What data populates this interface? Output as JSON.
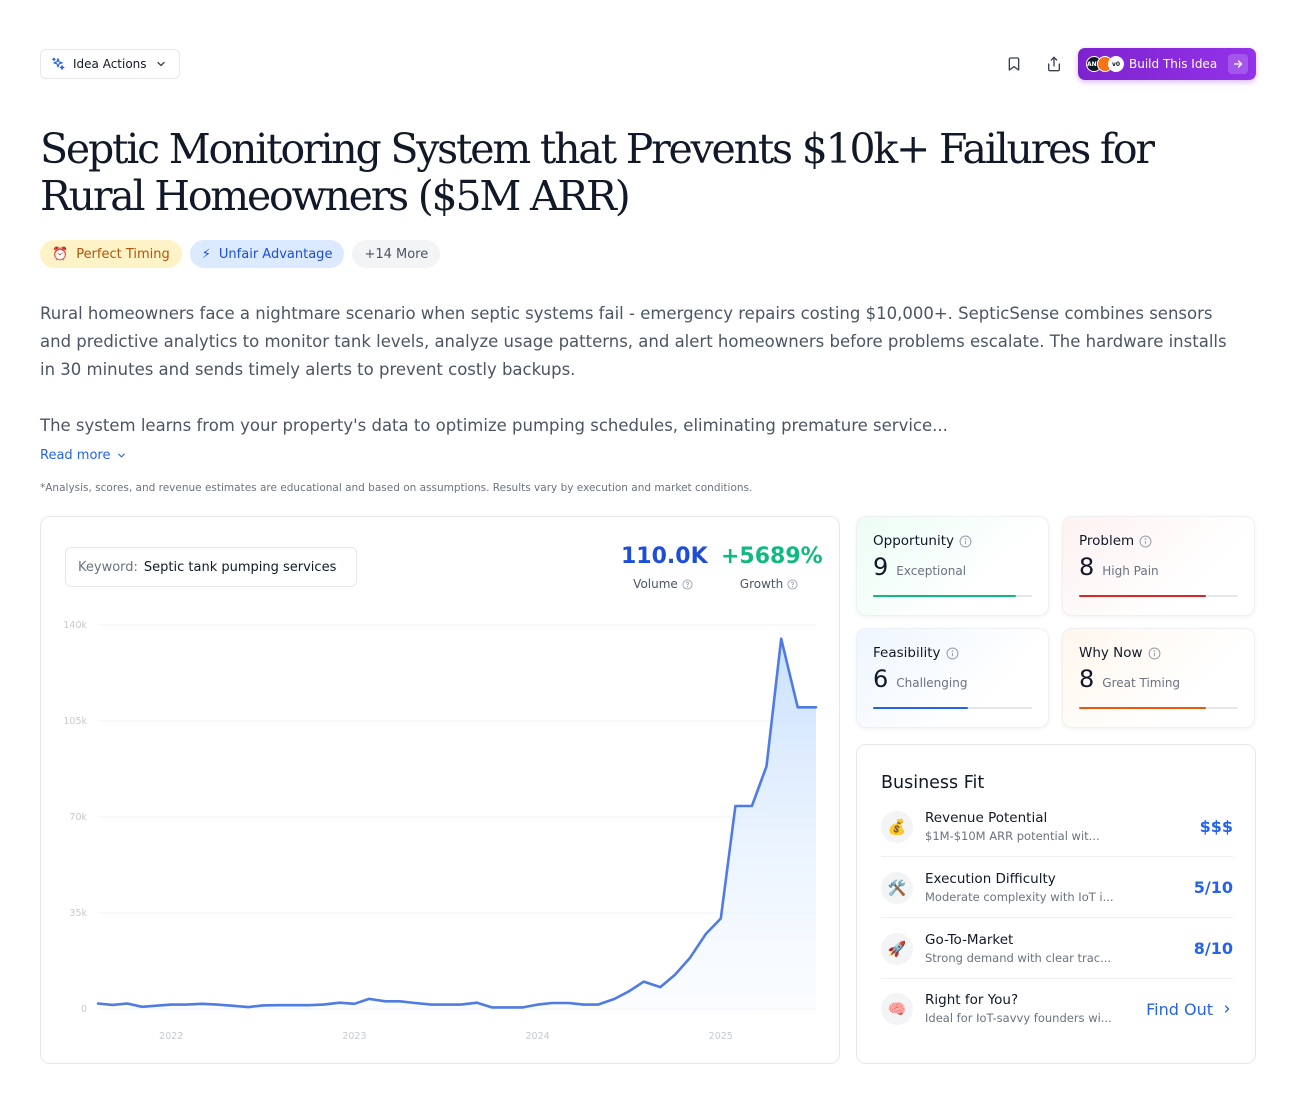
{
  "toolbar": {
    "idea_actions_label": "Idea Actions",
    "build_label": "Build This Idea",
    "logo_1": "ANY",
    "logo_3": "v0"
  },
  "title": "Septic Monitoring System that Prevents $10k+ Failures for Rural Homeowners ($5M ARR)",
  "tags": [
    {
      "icon": "⏰",
      "label": "Perfect Timing"
    },
    {
      "icon": "⚡",
      "label": "Unfair Advantage"
    },
    {
      "label": "+14 More"
    }
  ],
  "description": {
    "paragraph_1": "Rural homeowners face a nightmare scenario when septic systems fail - emergency repairs costing $10,000+. SepticSense combines sensors and predictive analytics to monitor tank levels, analyze usage patterns, and alert homeowners before problems escalate. The hardware installs in 30 minutes and sends timely alerts to prevent costly backups.",
    "paragraph_2": "The system learns from your property's data to optimize pumping schedules, eliminating premature service..."
  },
  "read_more": "Read more",
  "disclaimer": "*Analysis, scores, and revenue estimates are educational and based on assumptions. Results vary by execution and market conditions.",
  "keyword": {
    "label": "Keyword:",
    "value": "Septic tank pumping services"
  },
  "stats": {
    "volume_value": "110.0K",
    "volume_label": "Volume",
    "growth_value": "+5689%",
    "growth_label": "Growth"
  },
  "colors": {
    "line": "#4f7be3",
    "growth": "#16a34a",
    "volume": "#1d4ed8"
  },
  "chart_data": {
    "type": "area",
    "xlabel": "",
    "ylabel": "",
    "ylim": [
      0,
      140000
    ],
    "y_ticks": [
      {
        "value": 0,
        "label": "0"
      },
      {
        "value": 35000,
        "label": "35k"
      },
      {
        "value": 70000,
        "label": "70k"
      },
      {
        "value": 105000,
        "label": "105k"
      },
      {
        "value": 140000,
        "label": "140k"
      }
    ],
    "x_range": [
      2021.6,
      2025.52
    ],
    "x_ticks": [
      {
        "value": 2022,
        "label": "2022"
      },
      {
        "value": 2023,
        "label": "2023"
      },
      {
        "value": 2024,
        "label": "2024"
      },
      {
        "value": 2025,
        "label": "2025"
      }
    ],
    "grid": true,
    "series": [
      {
        "x": [
          2021.6,
          2021.68,
          2021.76,
          2021.84,
          2021.92,
          2022.0,
          2022.08,
          2022.17,
          2022.25,
          2022.33,
          2022.42,
          2022.5,
          2022.58,
          2022.67,
          2022.75,
          2022.83,
          2022.92,
          2023.0,
          2023.08,
          2023.17,
          2023.25,
          2023.33,
          2023.42,
          2023.5,
          2023.58,
          2023.67,
          2023.75,
          2023.83,
          2023.92,
          2024.0,
          2024.08,
          2024.17,
          2024.25,
          2024.33,
          2024.42,
          2024.5,
          2024.58,
          2024.67,
          2024.75,
          2024.83,
          2024.92,
          2025.0,
          2025.08,
          2025.17,
          2025.25,
          2025.33,
          2025.42,
          2025.52
        ],
        "y": [
          2000,
          1500,
          2000,
          800,
          1200,
          1600,
          1600,
          1900,
          1600,
          1200,
          700,
          1300,
          1400,
          1400,
          1400,
          1600,
          2300,
          1900,
          3700,
          2800,
          2800,
          2200,
          1600,
          1600,
          1600,
          2300,
          600,
          600,
          600,
          1600,
          2200,
          2200,
          1600,
          1600,
          3700,
          6500,
          10000,
          8000,
          12500,
          18500,
          27500,
          33000,
          74000,
          74000,
          88500,
          135000,
          110000,
          110000
        ]
      }
    ]
  },
  "scores": {
    "opportunity": {
      "label": "Opportunity",
      "score": "9",
      "text": "Exceptional",
      "fraction": 0.9
    },
    "problem": {
      "label": "Problem",
      "score": "8",
      "text": "High Pain",
      "fraction": 0.8
    },
    "feasibility": {
      "label": "Feasibility",
      "score": "6",
      "text": "Challenging",
      "fraction": 0.6
    },
    "why_now": {
      "label": "Why Now",
      "score": "8",
      "text": "Great Timing",
      "fraction": 0.8
    }
  },
  "business_fit": {
    "title": "Business Fit",
    "rows": [
      {
        "icon": "💰",
        "name": "Revenue Potential",
        "desc": "$1M-$10M ARR potential wit...",
        "value": "$$$"
      },
      {
        "icon": "🛠️",
        "name": "Execution Difficulty",
        "desc": "Moderate complexity with IoT i...",
        "value": "5/10"
      },
      {
        "icon": "🚀",
        "name": "Go-To-Market",
        "desc": "Strong demand with clear trac...",
        "value": "8/10"
      },
      {
        "icon": "🧠",
        "name": "Right for You?",
        "desc": "Ideal for IoT-savvy founders wi...",
        "value": "Find Out"
      }
    ]
  }
}
